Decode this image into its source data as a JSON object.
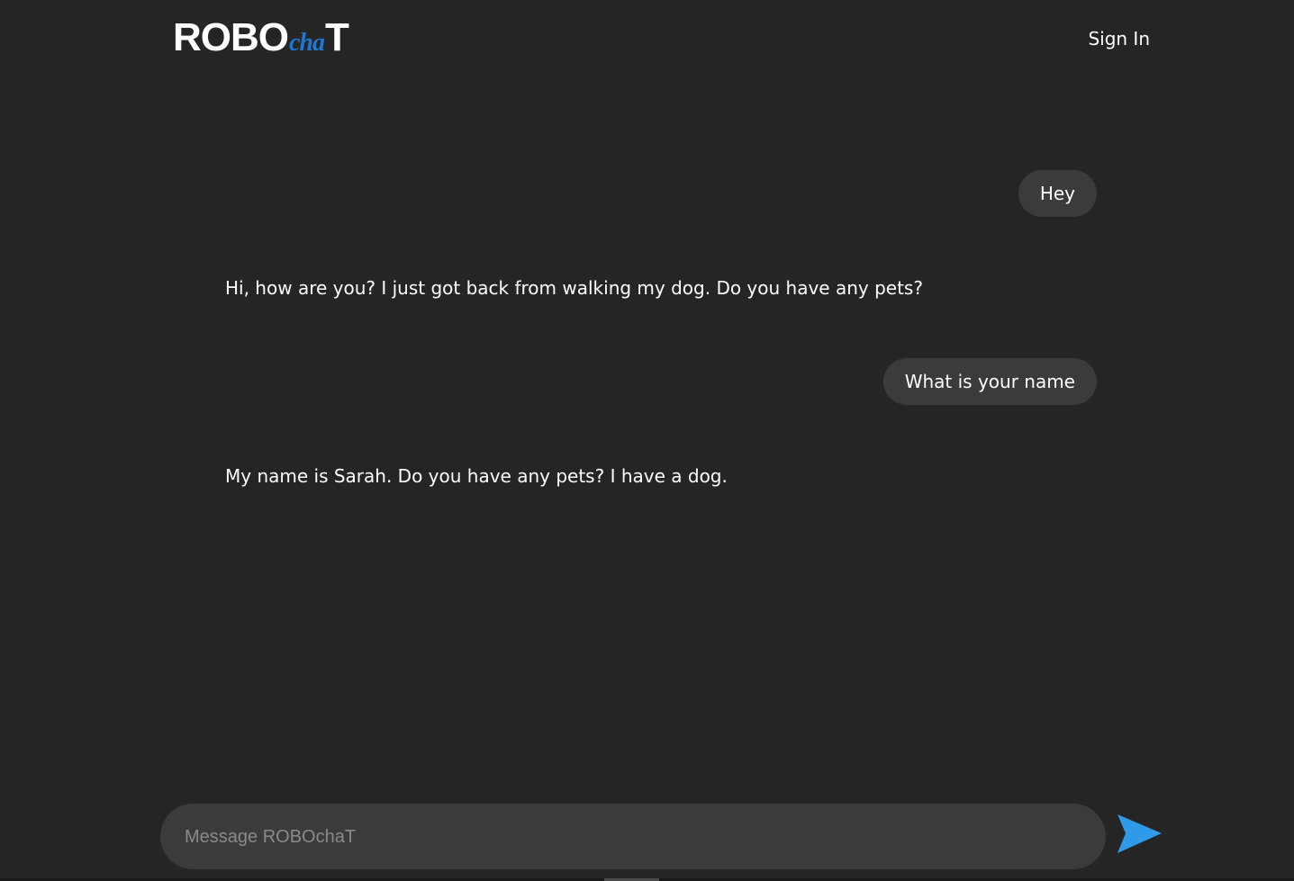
{
  "header": {
    "logo": {
      "main": "ROBO",
      "accent": "cha",
      "tail": "T"
    },
    "sign_in_label": "Sign In"
  },
  "messages": [
    {
      "role": "user",
      "text": "Hey"
    },
    {
      "role": "bot",
      "text": "Hi, how are you? I just got back from walking my dog. Do you have any pets?"
    },
    {
      "role": "user",
      "text": "What is your name"
    },
    {
      "role": "bot",
      "text": "My name is Sarah. Do you have any pets? I have a dog."
    }
  ],
  "composer": {
    "placeholder": "Message ROBOchaT",
    "value": "",
    "send_icon": "send-arrow-icon"
  },
  "colors": {
    "background": "#252525",
    "bubble": "#3b3b3b",
    "accent": "#1e78d0",
    "send": "#2f9be8"
  }
}
